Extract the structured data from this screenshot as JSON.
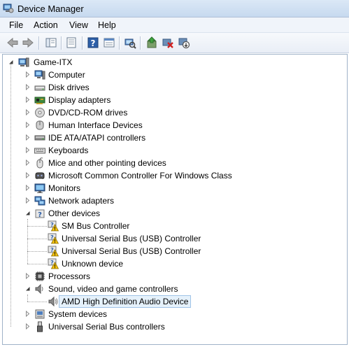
{
  "window": {
    "title": "Device Manager"
  },
  "menu": [
    "File",
    "Action",
    "View",
    "Help"
  ],
  "toolbar": {
    "buttons": [
      "back-icon",
      "forward-icon",
      "show-hide-console-tree-icon",
      "properties-icon",
      "help-icon",
      "details-view-icon",
      "scan-hardware-icon",
      "update-driver-icon",
      "uninstall-icon",
      "disable-icon"
    ]
  },
  "tree": {
    "root": "Game-ITX",
    "categories": [
      {
        "label": "Computer",
        "icon": "computer-icon",
        "expanded": false
      },
      {
        "label": "Disk drives",
        "icon": "disk-drive-icon",
        "expanded": false
      },
      {
        "label": "Display adapters",
        "icon": "display-adapter-icon",
        "expanded": false
      },
      {
        "label": "DVD/CD-ROM drives",
        "icon": "dvd-drive-icon",
        "expanded": false
      },
      {
        "label": "Human Interface Devices",
        "icon": "hid-icon",
        "expanded": false
      },
      {
        "label": "IDE ATA/ATAPI controllers",
        "icon": "ide-controller-icon",
        "expanded": false
      },
      {
        "label": "Keyboards",
        "icon": "keyboard-icon",
        "expanded": false
      },
      {
        "label": "Mice and other pointing devices",
        "icon": "mouse-icon",
        "expanded": false
      },
      {
        "label": "Microsoft Common Controller For Windows Class",
        "icon": "controller-icon",
        "expanded": false
      },
      {
        "label": "Monitors",
        "icon": "monitor-icon",
        "expanded": false
      },
      {
        "label": "Network adapters",
        "icon": "network-adapter-icon",
        "expanded": false
      },
      {
        "label": "Other devices",
        "icon": "unknown-device-icon",
        "expanded": true,
        "children": [
          {
            "label": "SM Bus Controller",
            "icon": "warning-device-icon"
          },
          {
            "label": "Universal Serial Bus (USB) Controller",
            "icon": "warning-device-icon"
          },
          {
            "label": "Universal Serial Bus (USB) Controller",
            "icon": "warning-device-icon"
          },
          {
            "label": "Unknown device",
            "icon": "warning-device-icon"
          }
        ]
      },
      {
        "label": "Processors",
        "icon": "processor-icon",
        "expanded": false
      },
      {
        "label": "Sound, video and game controllers",
        "icon": "sound-icon",
        "expanded": true,
        "children": [
          {
            "label": "AMD High Definition Audio Device",
            "icon": "speaker-icon",
            "selected": true
          }
        ]
      },
      {
        "label": "System devices",
        "icon": "system-device-icon",
        "expanded": false
      },
      {
        "label": "Universal Serial Bus controllers",
        "icon": "usb-icon",
        "expanded": false
      }
    ]
  }
}
